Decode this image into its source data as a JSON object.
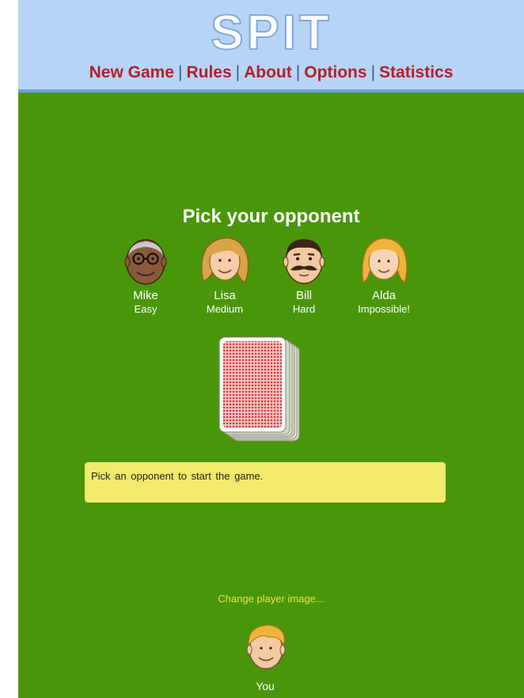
{
  "app": {
    "title": "SPIT"
  },
  "nav": {
    "items": [
      {
        "label": "New Game"
      },
      {
        "label": "Rules"
      },
      {
        "label": "About"
      },
      {
        "label": "Options"
      },
      {
        "label": "Statistics"
      }
    ],
    "separator": "|"
  },
  "main": {
    "title": "Pick your opponent",
    "opponents": [
      {
        "name": "Mike",
        "level": "Easy"
      },
      {
        "name": "Lisa",
        "level": "Medium"
      },
      {
        "name": "Bill",
        "level": "Hard"
      },
      {
        "name": "Alda",
        "level": "Impossible!"
      }
    ],
    "message": "Pick an opponent to start the game.",
    "change_player_image": "Change player image...",
    "you_label": "You"
  },
  "colors": {
    "header_bg": "#b7d4f7",
    "table_green": "#4a960a",
    "nav_link": "#b3202a",
    "message_bg": "#f1ea6c",
    "card_red": "#d93a3a"
  },
  "icons": [
    "spit-logo",
    "mike-avatar-icon",
    "lisa-avatar-icon",
    "bill-avatar-icon",
    "alda-avatar-icon",
    "card-deck",
    "you-avatar-icon"
  ]
}
